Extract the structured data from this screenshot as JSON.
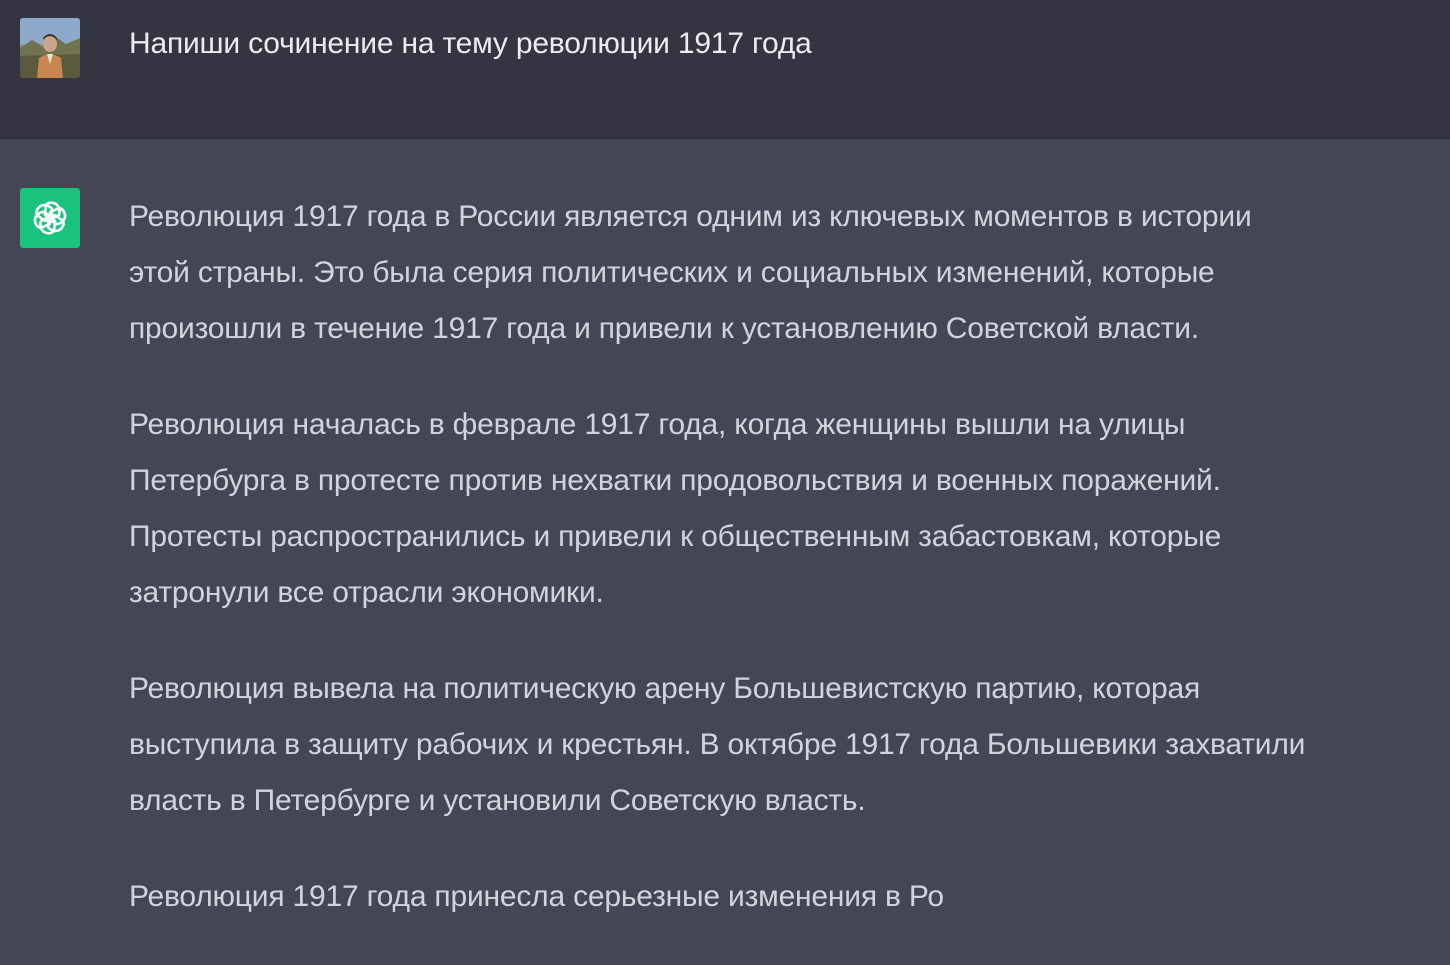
{
  "conversation": {
    "user": {
      "avatar": "user-photo-avatar",
      "message": "Напиши сочинение на тему революции 1917 года"
    },
    "assistant": {
      "avatar": "openai-logo-icon",
      "accent": "#19c37d",
      "paragraphs": [
        {
          "lines": [
            "Революция 1917 года в России является одним из ключевых моментов в истории",
            "этой страны. Это была серия политических и социальных изменений, которые",
            "произошли в течение 1917 года и привели к установлению Советской власти."
          ]
        },
        {
          "lines": [
            "Революция началась в феврале 1917 года, когда женщины вышли на улицы",
            "Петербурга в протесте против нехватки продовольствия и военных поражений.",
            "Протесты распространились и привели к общественным забастовкам, которые",
            "затронули все отрасли экономики."
          ]
        },
        {
          "lines": [
            "Революция вывела на политическую арену Большевистскую партию, которая",
            "выступила в защиту рабочих и крестьян. В октябре 1917 года Большевики захватили",
            "власть в Петербурге и установили Советскую власть."
          ]
        },
        {
          "lines": [
            "Революция 1917 года принесла серьезные изменения в Ро"
          ]
        }
      ]
    }
  },
  "colors": {
    "user_bg": "#343541",
    "assistant_bg": "#444654",
    "user_text": "#ececf1",
    "assistant_text": "#d1d5db"
  }
}
